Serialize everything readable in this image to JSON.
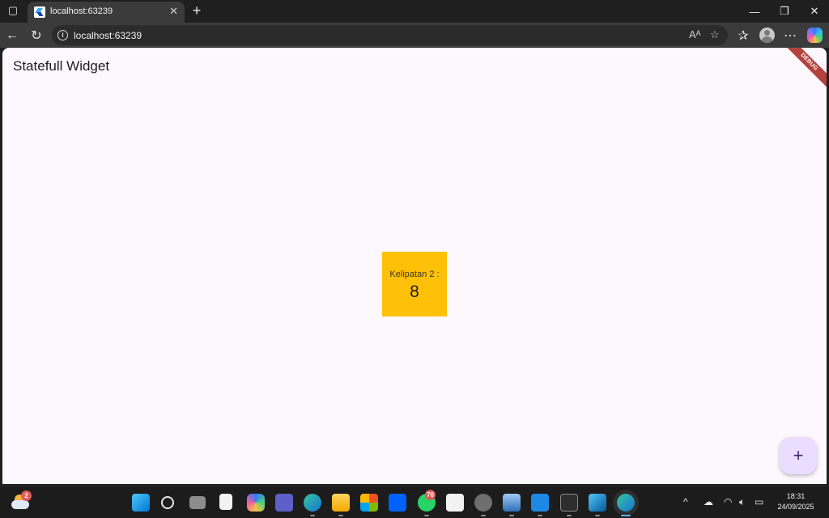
{
  "browser": {
    "tab_title": "localhost:63239",
    "url": "localhost:63239"
  },
  "app": {
    "title": "Statefull Widget",
    "debug_banner": "DEBUG",
    "box_label": "Kelipatan 2 :",
    "box_value": "8",
    "box_color": "#ffc107",
    "fab_icon": "plus-icon"
  },
  "taskbar": {
    "weather_badge": "2",
    "whatsapp_badge": "70",
    "time": "18:31",
    "date": "24/09/2025",
    "pinned_apps": [
      "start",
      "search",
      "task-view",
      "files",
      "copilot",
      "teams",
      "edge",
      "file-explorer",
      "microsoft-store",
      "dropbox",
      "whatsapp",
      "amazon",
      "settings",
      "remote-desktop",
      "vscode",
      "terminal",
      "flutter",
      "edge-active"
    ]
  }
}
